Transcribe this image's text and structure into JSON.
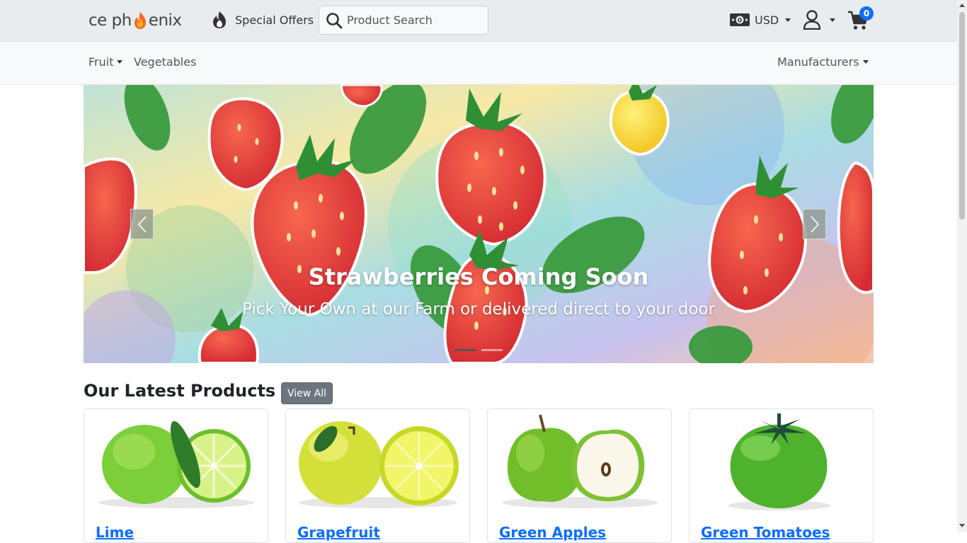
{
  "header": {
    "logo_text_left": "ce ph",
    "logo_text_right": "enix",
    "special_offers_label": "Special Offers",
    "search_placeholder": "Product Search",
    "currency": "USD",
    "cart_count": "0",
    "icons": {
      "special_offers": "flame-icon",
      "search": "search-icon",
      "currency": "money-icon",
      "account": "user-icon",
      "cart": "cart-icon"
    }
  },
  "nav": {
    "items": [
      {
        "label": "Fruit",
        "has_dropdown": true
      },
      {
        "label": "Vegetables",
        "has_dropdown": false
      }
    ],
    "manufacturers_label": "Manufacturers"
  },
  "carousel": {
    "title": "Strawberries Coming Soon",
    "subtitle": "Pick Your Own at our Farm or delivered direct to your door",
    "slides": 2,
    "active_slide": 1
  },
  "latest": {
    "title": "Our Latest Products",
    "view_all_label": "View All",
    "products": [
      {
        "name": "Lime"
      },
      {
        "name": "Grapefruit"
      },
      {
        "name": "Green Apples"
      },
      {
        "name": "Green Tomatoes"
      }
    ]
  },
  "colors": {
    "accent": "#0d6efd",
    "topbar_bg": "#e9ecef",
    "navbar_bg": "#f8f9fa",
    "button_secondary": "#6c757d"
  }
}
